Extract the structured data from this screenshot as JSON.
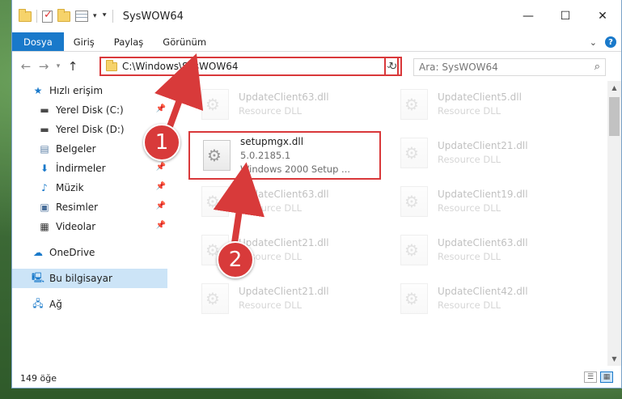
{
  "window": {
    "title": "SysWOW64"
  },
  "ribbon": {
    "tabs": [
      "Dosya",
      "Giriş",
      "Paylaş",
      "Görünüm"
    ]
  },
  "address": {
    "path": "C:\\Windows\\SysWOW64"
  },
  "search": {
    "placeholder": "Ara: SysWOW64"
  },
  "sidebar": {
    "items": [
      {
        "label": "Hızlı erişim",
        "icon": "star-icon"
      },
      {
        "label": "Yerel Disk (C:)",
        "icon": "drive-icon",
        "pinned": true
      },
      {
        "label": "Yerel Disk (D:)",
        "icon": "drive-icon"
      },
      {
        "label": "Belgeler",
        "icon": "documents-icon"
      },
      {
        "label": "İndirmeler",
        "icon": "download-icon",
        "pinned": true
      },
      {
        "label": "Müzik",
        "icon": "music-icon",
        "pinned": true
      },
      {
        "label": "Resimler",
        "icon": "pictures-icon",
        "pinned": true
      },
      {
        "label": "Videolar",
        "icon": "videos-icon",
        "pinned": true
      },
      {
        "label": "OneDrive",
        "icon": "cloud-icon"
      },
      {
        "label": "Bu bilgisayar",
        "icon": "computer-icon",
        "selected": true
      },
      {
        "label": "Ağ",
        "icon": "network-icon"
      }
    ]
  },
  "files": {
    "highlighted": {
      "name": "setupmgx.dll",
      "version": "5.0.2185.1",
      "description": "Windows 2000 Setup ..."
    },
    "faded": [
      {
        "name": "UpdateClient63.dll",
        "type": "Resource DLL"
      },
      {
        "name": "UpdateClient5.dll",
        "type": "Resource DLL"
      },
      {
        "name": "UpdateClient21.dll",
        "type": "Resource DLL"
      },
      {
        "name": "UpdateClient63.dll",
        "type": "Resource DLL"
      },
      {
        "name": "UpdateClient19.dll",
        "type": "Resource DLL"
      },
      {
        "name": "UpdateClient21.dll",
        "type": "Resource DLL"
      },
      {
        "name": "UpdateClient63.dll",
        "type": "Resource DLL"
      },
      {
        "name": "UpdateClient21.dll",
        "type": "Resource DLL"
      },
      {
        "name": "UpdateClient42.dll",
        "type": "Resource DLL"
      }
    ]
  },
  "status": {
    "count": "149 öğe"
  },
  "callouts": [
    "1",
    "2"
  ],
  "colors": {
    "accent": "#1979ca",
    "highlight": "#d9383a",
    "selection": "#cce4f7"
  }
}
